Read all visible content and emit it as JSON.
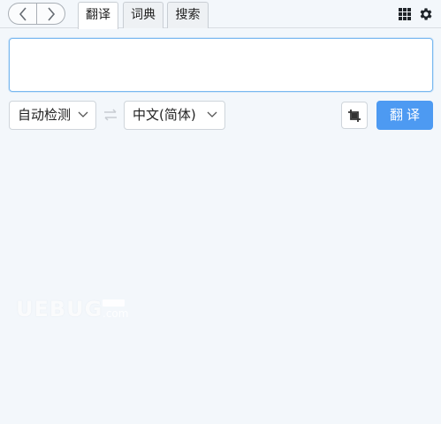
{
  "nav": {
    "back_icon": "chevron-left-icon",
    "forward_icon": "chevron-right-icon"
  },
  "tabs": [
    {
      "label": "翻译",
      "active": true
    },
    {
      "label": "词典",
      "active": false
    },
    {
      "label": "搜索",
      "active": false
    }
  ],
  "toolbar": {
    "apps_icon": "grid-icon",
    "settings_icon": "gear-icon"
  },
  "input": {
    "value": "",
    "placeholder": ""
  },
  "source_language": {
    "selected": "自动检测"
  },
  "target_language": {
    "selected": "中文(简体)"
  },
  "swap_icon": "swap-arrows-icon",
  "crop_icon": "crop-icon",
  "translate_button": {
    "label": "翻译"
  },
  "watermark": {
    "text": "UEBUG",
    "suffix": ".com"
  },
  "colors": {
    "accent": "#4d9af2",
    "background": "#f3f7fb",
    "focus_border": "#79b8f0"
  }
}
